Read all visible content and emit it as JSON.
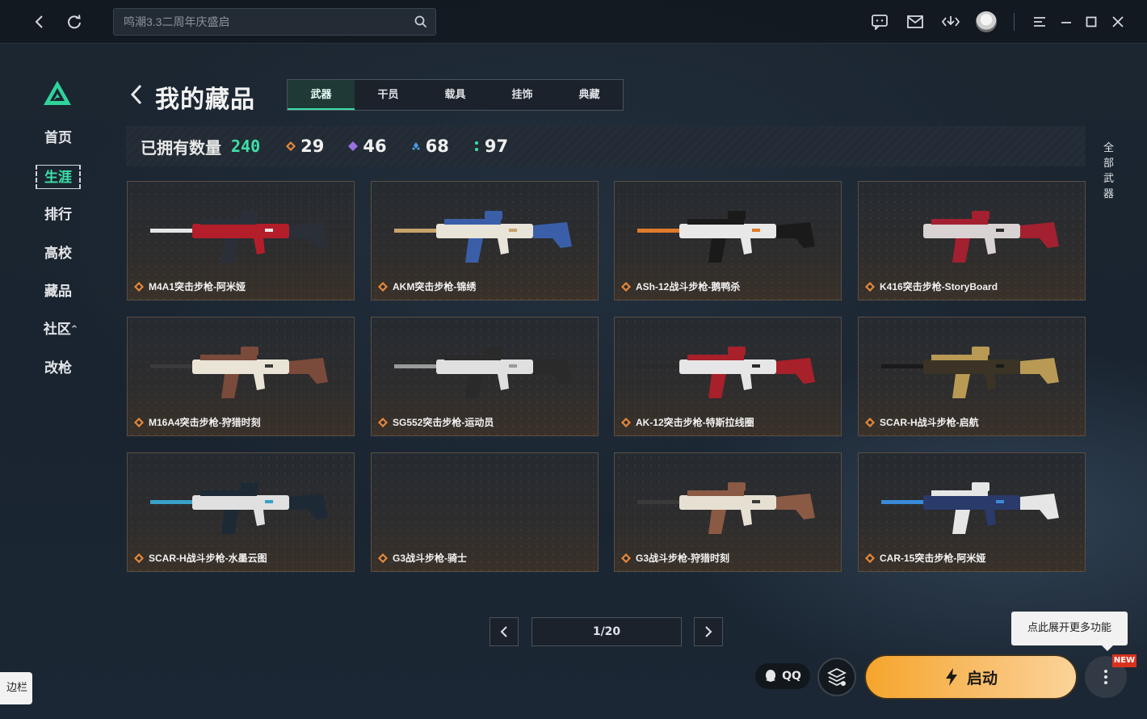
{
  "topbar": {
    "search_placeholder": "鸣潮3.3二周年庆盛启",
    "icons": [
      "back-icon",
      "refresh-icon",
      "search-icon",
      "message-icon",
      "mail-icon",
      "download-icon",
      "avatar",
      "menu-icon",
      "minimize-icon",
      "maximize-icon",
      "close-icon"
    ]
  },
  "sidebar": {
    "items": [
      {
        "label": "首页"
      },
      {
        "label": "生涯",
        "active": true
      },
      {
        "label": "排行"
      },
      {
        "label": "高校"
      },
      {
        "label": "藏品"
      },
      {
        "label": "社区"
      },
      {
        "label": "改枪"
      }
    ]
  },
  "header": {
    "title": "我的藏品",
    "tabs": [
      "武器",
      "干员",
      "载具",
      "挂饰",
      "典藏"
    ],
    "active_tab": "武器"
  },
  "stats": {
    "owned_label": "已拥有数量",
    "owned_count": "240",
    "tiers": [
      {
        "color": "#e8893a",
        "count": "29"
      },
      {
        "color": "#9b6fe0",
        "count": "46"
      },
      {
        "color": "#4a9ee8",
        "count": "68"
      },
      {
        "color": "#3de0a8",
        "count": "97"
      }
    ],
    "filter_label": "全部武器"
  },
  "weapons": [
    {
      "name": "M4A1突击步枪-阿米娅",
      "palette": [
        "#b41e2a",
        "#2a2f38",
        "#e6e6e6"
      ]
    },
    {
      "name": "AKM突击步枪-锦绣",
      "palette": [
        "#e9e4d8",
        "#3a5fa8",
        "#c7a26a"
      ]
    },
    {
      "name": "ASh-12战斗步枪-鹅鸭杀",
      "palette": [
        "#e8e8e8",
        "#1a1a1a",
        "#e07a2a"
      ]
    },
    {
      "name": "K416突击步枪-StoryBoard",
      "palette": [
        "#d8d2d2",
        "#a32030",
        "#2b2b2b"
      ]
    },
    {
      "name": "M16A4突击步枪-狩猎时刻",
      "palette": [
        "#e9e4d6",
        "#7a4a3a",
        "#3a3a3a"
      ]
    },
    {
      "name": "SG552突击步枪-运动员",
      "palette": [
        "#e0e0e0",
        "#2a2a2a",
        "#9a9a9a"
      ]
    },
    {
      "name": "AK-12突击步枪-特斯拉线圈",
      "palette": [
        "#e6e6e6",
        "#a8202a",
        "#2a2a2a"
      ]
    },
    {
      "name": "SCAR-H战斗步枪-启航",
      "palette": [
        "#3a3326",
        "#b89a55",
        "#1a1a1a"
      ]
    },
    {
      "name": "SCAR-H战斗步枪-水墨云图",
      "palette": [
        "#e0e0e0",
        "#1d2a36",
        "#3aa0c8"
      ]
    },
    {
      "name": "G3战斗步枪-骑士",
      "palette": []
    },
    {
      "name": "G3战斗步枪-狩猎时刻",
      "palette": [
        "#e6e0d2",
        "#8a5a44",
        "#3a3a3a"
      ]
    },
    {
      "name": "CAR-15突击步枪-阿米娅",
      "palette": [
        "#2a3a6a",
        "#e6e6e6",
        "#3a8ad8"
      ]
    }
  ],
  "pager": {
    "text": "1/20"
  },
  "bottom": {
    "qq_label": "QQ",
    "launch_label": "启动",
    "new_badge": "NEW",
    "tooltip": "点此展开更多功能",
    "edge_tab": "边栏"
  },
  "colors": {
    "accent": "#3de0a8",
    "launch": "#f6a52b",
    "rarity_orange": "#e8893a"
  }
}
